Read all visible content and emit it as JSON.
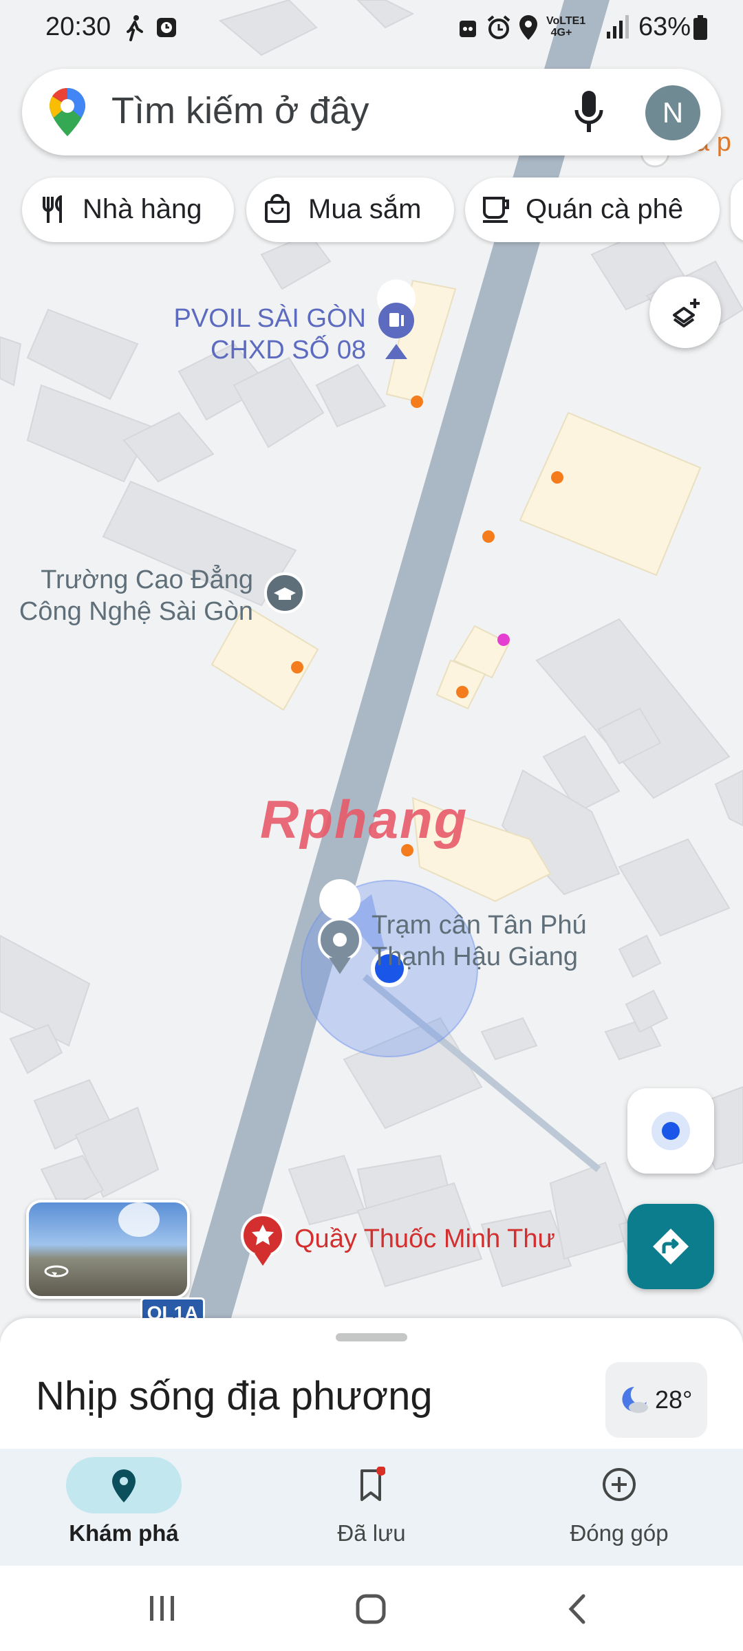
{
  "status_bar": {
    "time": "20:30",
    "network": "VoLTE1 4G+",
    "battery": "63%"
  },
  "search": {
    "placeholder": "Tìm kiếm ở đây",
    "avatar_letter": "N"
  },
  "chips": [
    {
      "label": "Nhà hàng",
      "icon": "restaurant-icon"
    },
    {
      "label": "Mua sắm",
      "icon": "shopping-bag-icon"
    },
    {
      "label": "Quán cà phê",
      "icon": "coffee-icon"
    }
  ],
  "map": {
    "places": [
      {
        "name_line1": "PVOIL SÀI GÒN",
        "name_line2": "CHXD SỐ 08",
        "icon": "gas-station-icon"
      },
      {
        "name_line1": "Trường Cao Đẳng",
        "name_line2": "Công Nghệ Sài Gòn",
        "icon": "school-icon"
      },
      {
        "name_line1": "Trạm cân Tân Phú",
        "name_line2": "Thạnh Hậu Giang",
        "icon": "map-pin-icon"
      },
      {
        "name_line1": "Quầy Thuốc Minh Thư",
        "icon": "pharmacy-icon"
      }
    ],
    "road_shield": "QL1A",
    "watermark": "Rphang",
    "partial_label": "a p"
  },
  "sheet": {
    "title": "Nhịp sống địa phương",
    "temperature": "28°"
  },
  "nav": {
    "items": [
      {
        "label": "Khám phá",
        "icon": "explore-pin-icon",
        "active": true
      },
      {
        "label": "Đã lưu",
        "icon": "bookmark-icon",
        "active": false
      },
      {
        "label": "Đóng góp",
        "icon": "add-circle-icon",
        "active": false
      }
    ]
  },
  "colors": {
    "road": "#aab7c4",
    "building": "#dfe1e4",
    "poi_building": "#fdf6e3",
    "orange_dot": "#f57c1c",
    "location_blue": "#1a56e8",
    "directions_teal": "#0b7d8c",
    "pharmacy_red": "#d32f2f",
    "place_label_purple": "#5c6bc0",
    "place_label_gray": "#5f6f7a"
  }
}
